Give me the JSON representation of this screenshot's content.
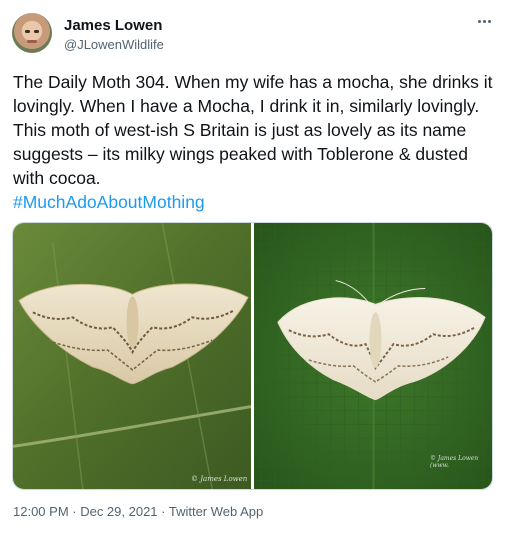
{
  "author": {
    "name": "James Lowen",
    "handle": "@JLowenWildlife"
  },
  "tweet": {
    "text": "The Daily Moth 304. When my wife has a mocha, she drinks it lovingly. When I have a Mocha, I drink it in, similarly lovingly. This moth of west-ish S Britain is just as lovely as its name suggests – its milky wings peaked with Toblerone & dusted with cocoa.",
    "hashtag": "#MuchAdoAboutMothing"
  },
  "media": {
    "photo_1_credit": "© James Lowen",
    "photo_2_credit": "© James Lowen (www."
  },
  "meta": {
    "timestamp": "12:00 PM · Dec 29, 2021 · Twitter Web App"
  },
  "colors": {
    "text": "#0f1419",
    "secondary": "#536471",
    "link": "#1d9bf0",
    "border": "#cfd9de"
  },
  "icons": {
    "more": "more-horizontal-icon"
  }
}
